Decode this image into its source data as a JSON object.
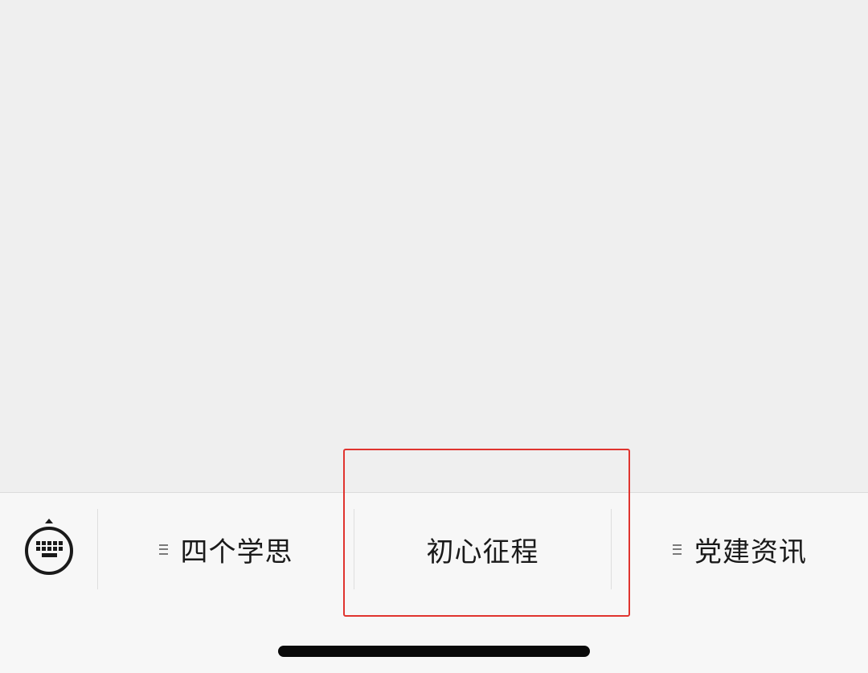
{
  "menu_bar": {
    "items": [
      {
        "label": "四个学思",
        "has_submenu": true
      },
      {
        "label": "初心征程",
        "has_submenu": false
      },
      {
        "label": "党建资讯",
        "has_submenu": true
      }
    ]
  },
  "icons": {
    "keyboard_toggle": "keyboard-icon",
    "submenu": "menu-lines-icon"
  },
  "colors": {
    "content_bg": "#efefef",
    "menu_bg": "#f7f7f7",
    "highlight": "#e0342f",
    "text": "#1a1a1a"
  }
}
